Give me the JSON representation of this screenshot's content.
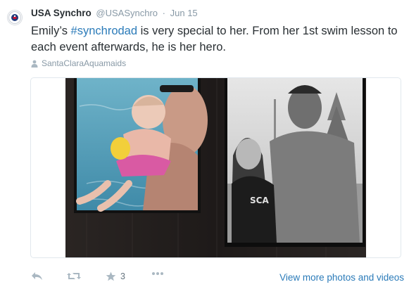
{
  "tweet": {
    "author_name": "USA Synchro",
    "author_handle": "@USASynchro",
    "separator": "·",
    "timestamp": "Jun 15",
    "text_before": "Emily’s ",
    "hashtag": "#synchrodad",
    "text_after": " is very special to her.  From her 1st swim lesson to each event afterwards, he is her hero.",
    "location": "SantaClaraAquamaids",
    "favorite_count": "3",
    "view_more_label": "View more photos and videos"
  },
  "media": {
    "shirt_text": "SCA"
  },
  "colors": {
    "link": "#2b7bb9",
    "muted": "#8899a6",
    "icon": "#aab8c2",
    "text": "#292f33"
  },
  "icons": {
    "avatar": "usa-synchro-logo-icon",
    "location": "person-icon",
    "reply": "reply-icon",
    "retweet": "retweet-icon",
    "favorite": "star-icon",
    "more": "ellipsis-icon"
  }
}
